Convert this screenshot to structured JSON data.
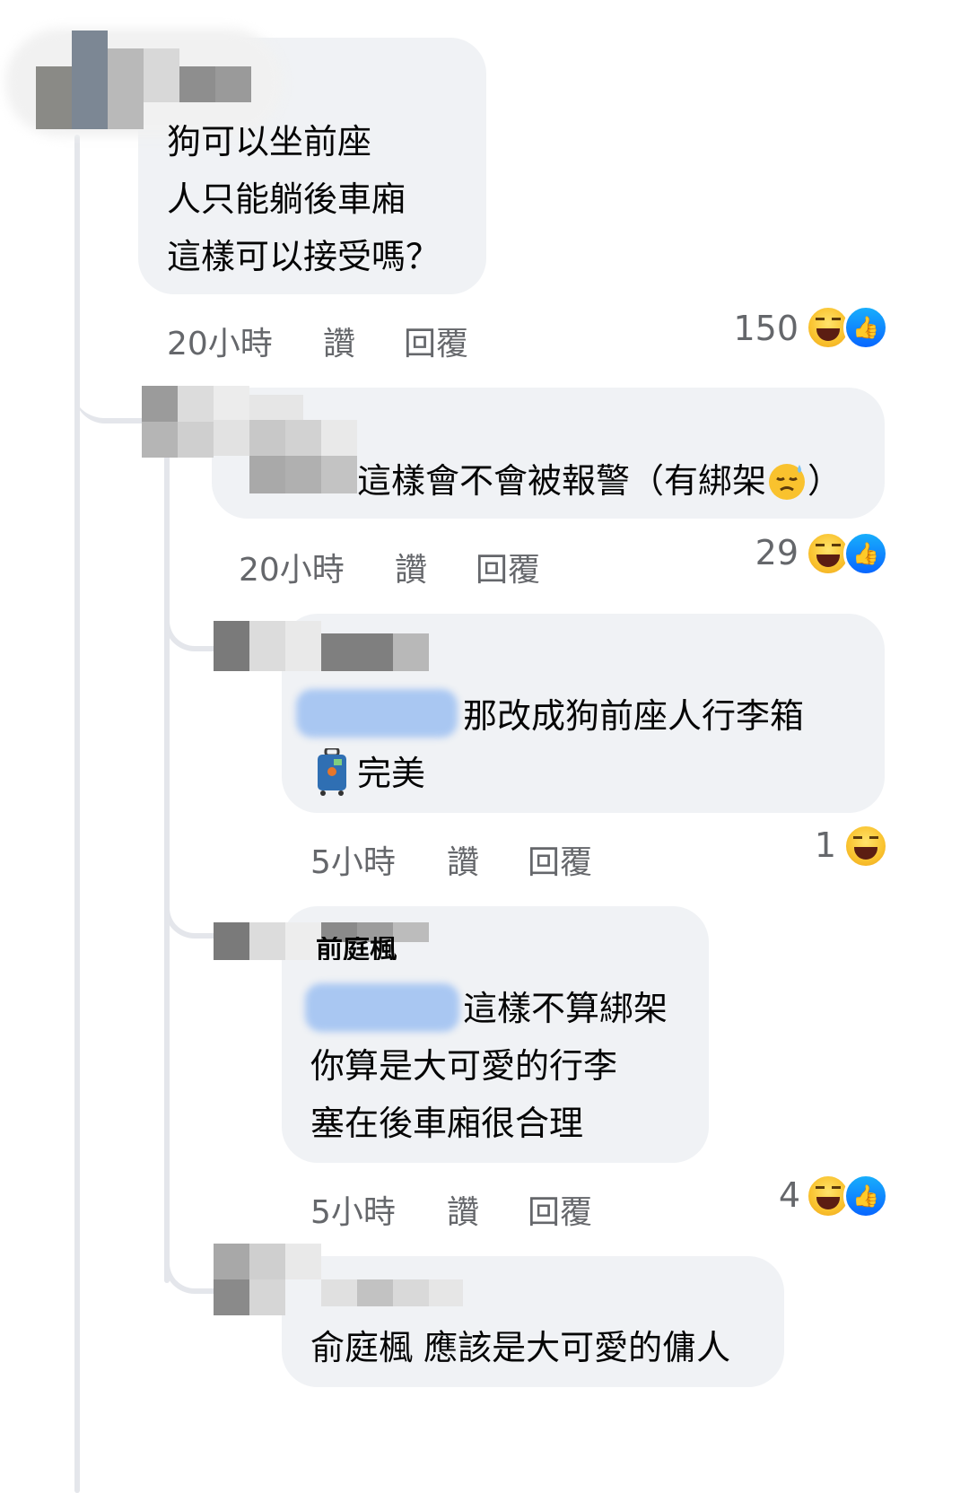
{
  "comments": [
    {
      "lines": [
        "狗可以坐前座",
        "人只能躺後車廂",
        "這樣可以接受嗎？"
      ],
      "time": "20小時",
      "like_label": "讚",
      "reply_label": "回覆",
      "reaction_count": "150",
      "reactions": [
        "haha-icon",
        "like-icon"
      ]
    },
    {
      "lines": [
        "這樣會不會被報警（有綁架",
        "）"
      ],
      "emoji": "downcast-sweat-face-icon",
      "time": "20小時",
      "like_label": "讚",
      "reply_label": "回覆",
      "reaction_count": "29",
      "reactions": [
        "haha-icon",
        "like-icon"
      ]
    },
    {
      "lines": [
        "那改成狗前座人行李箱",
        "完美"
      ],
      "emoji": "luggage-icon",
      "time": "5小時",
      "like_label": "讚",
      "reply_label": "回覆",
      "reaction_count": "1",
      "reactions": [
        "haha-icon"
      ]
    },
    {
      "author_partial": "前庭楓",
      "lines": [
        "這樣不算綁架",
        "你算是大可愛的行李",
        "塞在後車廂很合理"
      ],
      "time": "5小時",
      "like_label": "讚",
      "reply_label": "回覆",
      "reaction_count": "4",
      "reactions": [
        "haha-icon",
        "like-icon"
      ]
    },
    {
      "lines": [
        "俞庭楓 應該是大可愛的傭人"
      ]
    }
  ],
  "colors": {
    "bubble": "#f0f2f5",
    "meta": "#65676b",
    "thread": "#e4e6eb",
    "like_blue": "#0866ff"
  }
}
